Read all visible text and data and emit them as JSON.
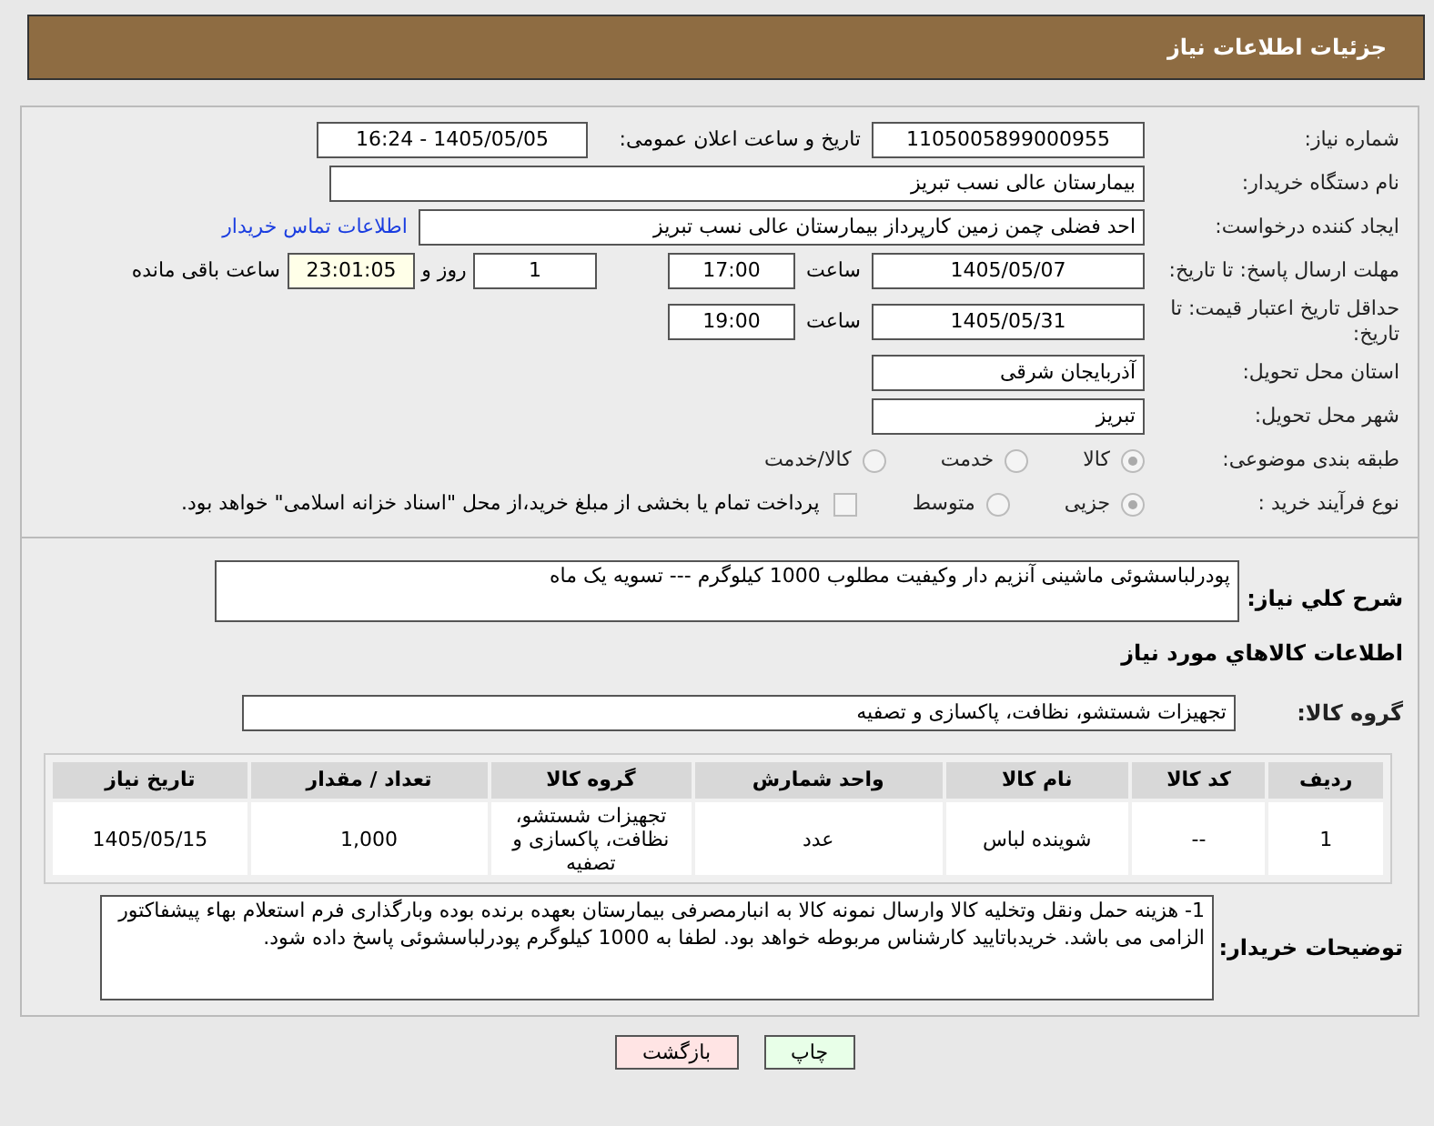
{
  "header": {
    "title": "جزئیات اطلاعات نیاز"
  },
  "need_number": {
    "label": "شماره نیاز:",
    "value": "1105005899000955"
  },
  "announce": {
    "label": "تاریخ و ساعت اعلان عمومی:",
    "value": "1405/05/05 - 16:24"
  },
  "buyer_org": {
    "label": "نام دستگاه خریدار:",
    "value": "بیمارستان عالی نسب تبریز"
  },
  "creator": {
    "label": "ایجاد کننده درخواست:",
    "value": "احد فضلی چمن زمین کارپرداز  بیمارستان عالی نسب تبریز",
    "link": "اطلاعات تماس خریدار"
  },
  "deadline": {
    "label": "مهلت ارسال پاسخ: تا تاریخ:",
    "date": "1405/05/07",
    "time_label": "ساعت",
    "time": "17:00",
    "days": "1",
    "days_label": "روز و",
    "remaining": "23:01:05",
    "remaining_label": "ساعت باقی مانده"
  },
  "price_validity": {
    "label": "حداقل تاریخ اعتبار قیمت: تا تاریخ:",
    "date": "1405/05/31",
    "time_label": "ساعت",
    "time": "19:00"
  },
  "province": {
    "label": "استان محل تحویل:",
    "value": "آذربایجان شرقی"
  },
  "city": {
    "label": "شهر محل تحویل:",
    "value": "تبریز"
  },
  "category": {
    "label": "طبقه بندی موضوعی:",
    "options": [
      {
        "label": "کالا",
        "selected": true
      },
      {
        "label": "خدمت",
        "selected": false
      },
      {
        "label": "کالا/خدمت",
        "selected": false
      }
    ]
  },
  "process": {
    "label": "نوع فرآیند خرید :",
    "options": [
      {
        "label": "جزیی",
        "selected": true
      },
      {
        "label": "متوسط",
        "selected": false
      }
    ],
    "payment": {
      "label": "پرداخت تمام یا بخشی از مبلغ خرید،از محل \"اسناد خزانه اسلامی\" خواهد بود.",
      "checked": false
    }
  },
  "description": {
    "label": "شرح کلي نياز:",
    "value": "پودرلباسشوئی ماشینی آنزیم دار وکیفیت مطلوب 1000 کیلوگرم --- تسویه یک ماه"
  },
  "goods_heading": "اطلاعات کالاهاي مورد نياز",
  "goods_group": {
    "label": "گروه کالا:",
    "value": "تجهیزات شستشو، نظافت، پاکسازی و تصفیه"
  },
  "table": {
    "columns": [
      "ردیف",
      "کد کالا",
      "نام کالا",
      "واحد شمارش",
      "گروه کالا",
      "تعداد / مقدار",
      "تاریخ نیاز"
    ],
    "rows": [
      [
        "1",
        "--",
        "شوینده لباس",
        "عدد",
        "تجهیزات شستشو، نظافت، پاکسازی و تصفیه",
        "1,000",
        "1405/05/15"
      ]
    ]
  },
  "buyer_notes": {
    "label": "توضیحات خریدار:",
    "value": "1- هزینه حمل ونقل وتخلیه کالا وارسال نمونه کالا به انبارمصرفی بیمارستان بعهده برنده بوده وبارگذاری فرم استعلام بهاء پیشفاکتور الزامی می باشد. خریدباتایید کارشناس مربوطه خواهد بود. لطفا به 1000 کیلوگرم پودرلباسشوئی پاسخ داده شود."
  },
  "buttons": [
    {
      "label": "چاپ",
      "kind": "print"
    },
    {
      "label": "بازگشت",
      "kind": "back"
    }
  ]
}
